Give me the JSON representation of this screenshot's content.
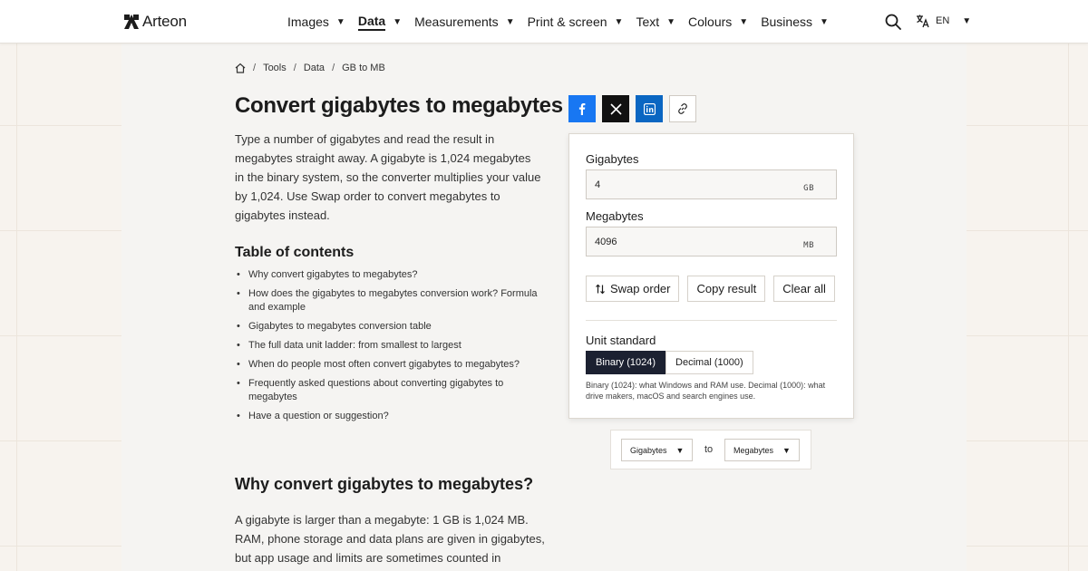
{
  "brand": {
    "name": "Arteon"
  },
  "nav": {
    "items": [
      {
        "label": "Images",
        "active": false
      },
      {
        "label": "Data",
        "active": true
      },
      {
        "label": "Measurements",
        "active": false
      },
      {
        "label": "Print & screen",
        "active": false
      },
      {
        "label": "Text",
        "active": false
      },
      {
        "label": "Colours",
        "active": false
      },
      {
        "label": "Business",
        "active": false
      }
    ],
    "language": "EN"
  },
  "breadcrumb": {
    "items": [
      "Tools",
      "Data",
      "GB to MB"
    ],
    "separator": "/"
  },
  "page": {
    "title": "Convert gigabytes to megabytes",
    "intro": "Type a number of gigabytes and read the result in megabytes straight away. A gigabyte is 1,024 megabytes in the binary system, so the converter multiplies your value by 1,024. Use Swap order to convert megabytes to gigabytes instead.",
    "toc_title": "Table of contents",
    "toc": [
      "Why convert gigabytes to megabytes?",
      "How does the gigabytes to megabytes conversion work? Formula and example",
      "Gigabytes to megabytes conversion table",
      "The full data unit ladder: from smallest to largest",
      "When do people most often convert gigabytes to megabytes?",
      "Frequently asked questions about converting gigabytes to megabytes",
      "Have a question or suggestion?"
    ],
    "section_heading": "Why convert gigabytes to megabytes?",
    "section_text": "A gigabyte is larger than a megabyte: 1 GB is 1,024 MB. RAM, phone storage and data plans are given in gigabytes, but app usage and limits are sometimes counted in"
  },
  "converter": {
    "input_label": "Gigabytes",
    "input_value": "4",
    "input_unit": "GB",
    "output_label": "Megabytes",
    "output_value": "4096",
    "output_unit": "MB",
    "swap_label": "Swap order",
    "copy_label": "Copy result",
    "clear_label": "Clear all",
    "standard_label": "Unit standard",
    "standard_binary": "Binary (1024)",
    "standard_decimal": "Decimal (1000)",
    "standard_selected": "binary",
    "standard_note": "Binary (1024): what Windows and RAM use. Decimal (1000): what drive makers, macOS and search engines use."
  },
  "unit_select": {
    "from": "Gigabytes",
    "to_word": "to",
    "to": "Megabytes"
  },
  "colors": {
    "accent": "#1c2131",
    "facebook": "#1877f2",
    "linkedin": "#0a66c2",
    "x": "#111111"
  },
  "icons": {
    "search": "search-icon",
    "language": "translate-icon",
    "home": "home-icon",
    "facebook": "facebook-icon",
    "x": "x-icon",
    "linkedin": "linkedin-icon",
    "link": "link-icon",
    "swap": "swap-icon"
  }
}
